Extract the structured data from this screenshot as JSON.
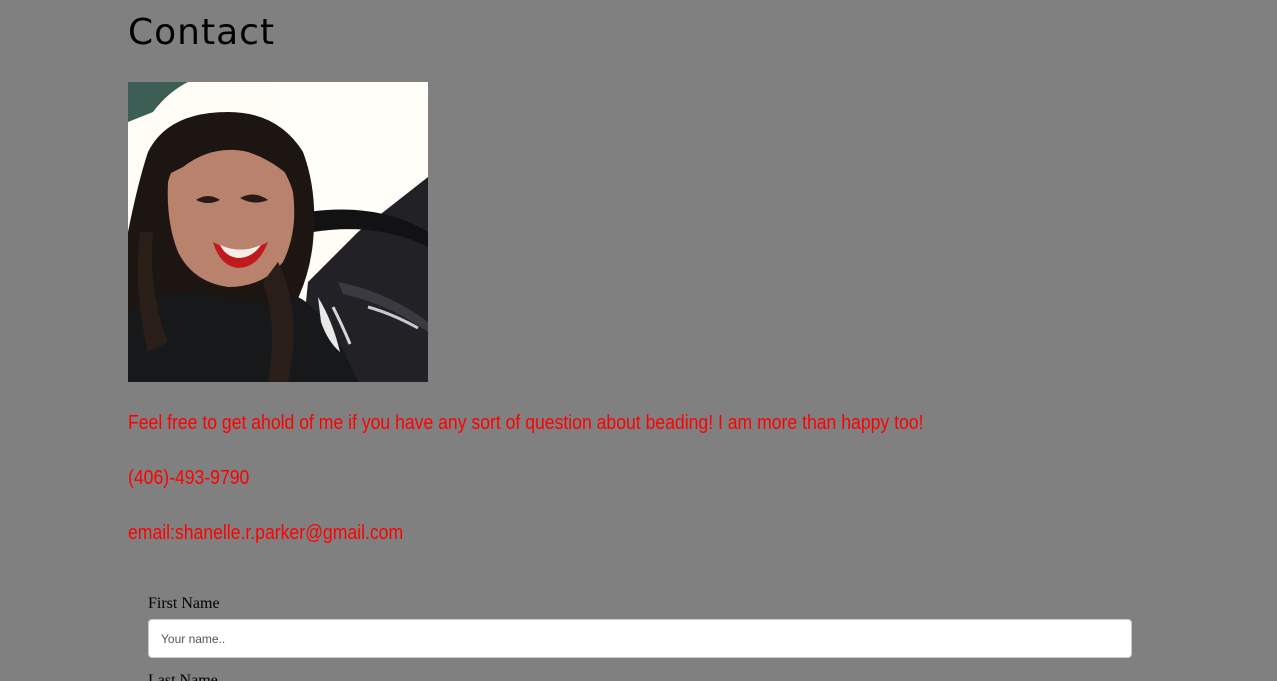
{
  "page": {
    "title": "Contact"
  },
  "profile_photo": {
    "alt": "Smiling woman with dark hair in a car"
  },
  "contact_info": {
    "message": "Feel free to get ahold of me if you have any sort of question about beading! I am more than happy too!",
    "phone": "(406)-493-9790",
    "email": "email:shanelle.r.parker@gmail.com"
  },
  "form": {
    "first_name_label": "First Name",
    "first_name_placeholder": "Your name..",
    "last_name_label": "Last Name"
  },
  "colors": {
    "background": "#808080",
    "accent_text": "#ff0000"
  }
}
